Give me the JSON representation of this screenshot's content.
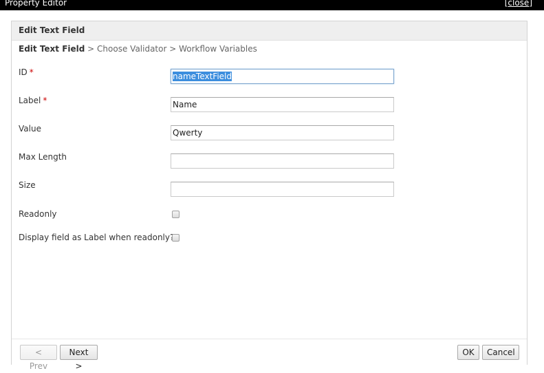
{
  "window": {
    "title": "Property Editor",
    "close_label": "close",
    "close_open_bracket": "[",
    "close_close_bracket": "]"
  },
  "panel": {
    "title": "Edit Text Field"
  },
  "breadcrumb": {
    "current": "Edit Text Field",
    "rest": " > Choose Validator > Workflow Variables"
  },
  "form": {
    "required_marker": "*",
    "id": {
      "label": "ID",
      "value": "nameTextField"
    },
    "label": {
      "label": "Label",
      "value": "Name"
    },
    "value": {
      "label": "Value",
      "value": "Qwerty"
    },
    "max_length": {
      "label": "Max Length",
      "value": ""
    },
    "size": {
      "label": "Size",
      "value": ""
    },
    "readonly": {
      "label": "Readonly",
      "checked": false
    },
    "display_label": {
      "label": "Display field as Label when readonly?",
      "checked": false
    }
  },
  "footer": {
    "prev_label": "< Prev",
    "next_label": "Next >",
    "ok_label": "OK",
    "cancel_label": "Cancel"
  }
}
